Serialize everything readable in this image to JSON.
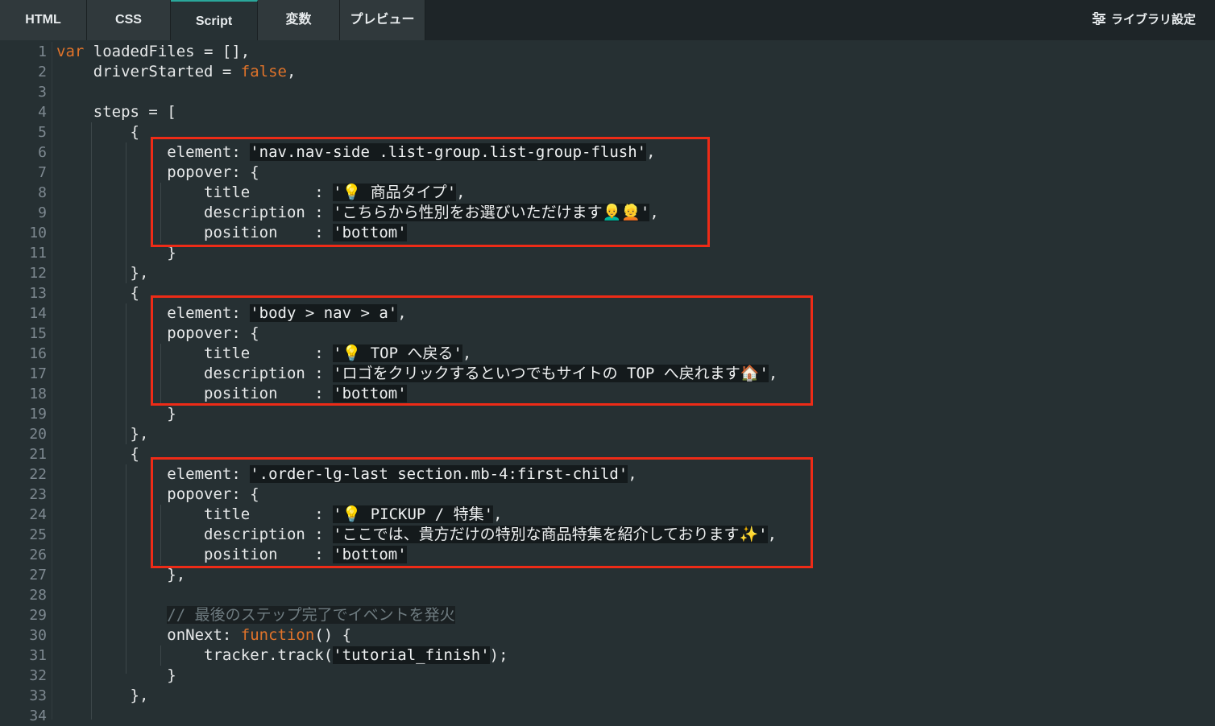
{
  "tabs": [
    {
      "label": "HTML"
    },
    {
      "label": "CSS"
    },
    {
      "label": "Script"
    },
    {
      "label": "変数"
    },
    {
      "label": "プレビュー"
    }
  ],
  "active_tab": "Script",
  "library_settings": {
    "label": "ライブラリ設定",
    "icon": "sliders-icon"
  },
  "colors": {
    "background": "#263033",
    "tabbar": "#1e2528",
    "keyword": "#e0732a",
    "highlight_box": "#ee2b17",
    "line_number": "#7d8890"
  },
  "code": {
    "line1_a": "loadedFiles = [],",
    "line2_a": "driverStarted = ",
    "line2_b": "false",
    "line4": "steps = [",
    "block1": {
      "element": "'nav.nav-side .list-group.list-group-flush'",
      "title": "'💡 商品タイプ'",
      "description": "'こちらから性別をお選びいただけます👱‍♂️👱'",
      "position": "'bottom'"
    },
    "block2": {
      "element": "'body > nav > a'",
      "title": "'💡 TOP へ戻る'",
      "description": "'ロゴをクリックするといつでもサイトの TOP へ戻れます🏠'",
      "position": "'bottom'"
    },
    "block3": {
      "element": "'.order-lg-last section.mb-4:first-child'",
      "title": "'💡 PICKUP / 特集'",
      "description": "'ここでは、貴方だけの特別な商品特集を紹介しております✨'",
      "position": "'bottom'"
    },
    "comment": "// 最後のステップ完了でイベントを発火",
    "onnext": "onNext: ",
    "function_kw": "function",
    "function_tail": "() {",
    "track_a": "tracker.track(",
    "track_str": "'tutorial_finish'",
    "track_b": ");"
  }
}
